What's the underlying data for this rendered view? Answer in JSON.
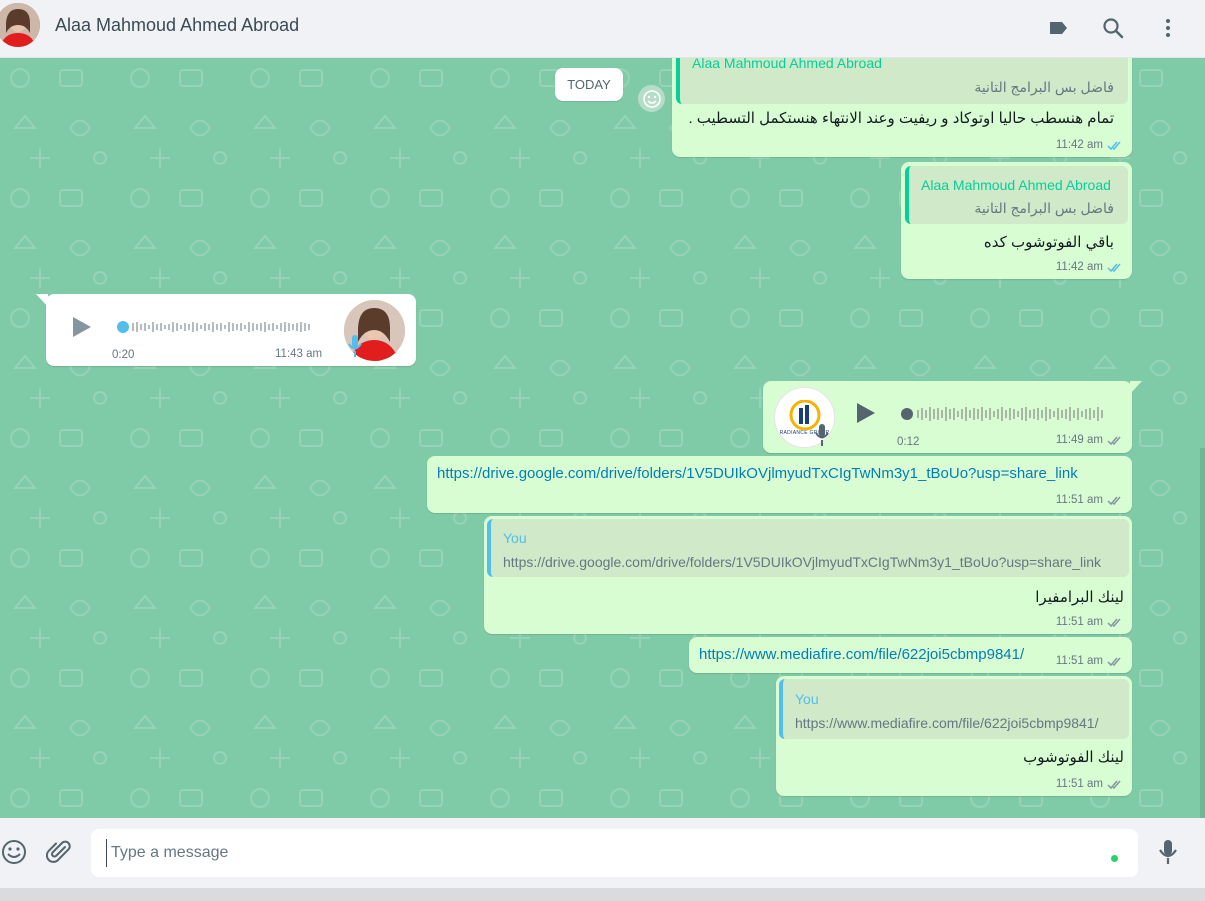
{
  "header": {
    "contact_name": "Alaa Mahmoud Ahmed Abroad",
    "icons": [
      "label-icon",
      "search-icon",
      "menu-icon"
    ]
  },
  "chat": {
    "date_label": "TODAY",
    "messages": [
      {
        "quote_author": "Alaa Mahmoud Ahmed Abroad",
        "quote_text": "فاضل بس البرامج التانية",
        "text": "تمام هنسطب حاليا اوتوكاد و ريفيت وعند الانتهاء هنستكمل التسطيب .",
        "time": "11:42 am"
      },
      {
        "quote_author": "Alaa Mahmoud Ahmed Abroad",
        "quote_text": "فاضل بس البرامج التانية",
        "text": "باقي الفوتوشوب كده",
        "time": "11:42 am"
      },
      {
        "type": "voice-in",
        "duration": "0:20",
        "time": "11:43 am"
      },
      {
        "type": "voice-out",
        "avatar_text": "RADIANCE GROUP",
        "duration": "0:12",
        "time": "11:49 am"
      },
      {
        "link": "https://drive.google.com/drive/folders/1V5DUIkOVjlmyudTxCIgTwNm3y1_tBoUo?usp=share_link",
        "time": "11:51 am"
      },
      {
        "quote_author": "You",
        "quote_text": "https://drive.google.com/drive/folders/1V5DUIkOVjlmyudTxCIgTwNm3y1_tBoUo?usp=share_link",
        "text": "لينك البرامفيرا",
        "time": "11:51 am"
      },
      {
        "link": "https://www.mediafire.com/file/622joi5cbmp9841/",
        "time": "11:51 am"
      },
      {
        "quote_author": "You",
        "quote_text": "https://www.mediafire.com/file/622joi5cbmp9841/",
        "text": "لينك الفوتوشوب",
        "time": "11:51 am"
      }
    ]
  },
  "composer": {
    "placeholder": "Type a message"
  },
  "colors": {
    "chat_bg": "#7fcaa7",
    "outgoing_bubble": "#d9fdd3",
    "incoming_bubble": "#ffffff",
    "tick_read": "#53bdeb",
    "link": "#027eb5"
  }
}
